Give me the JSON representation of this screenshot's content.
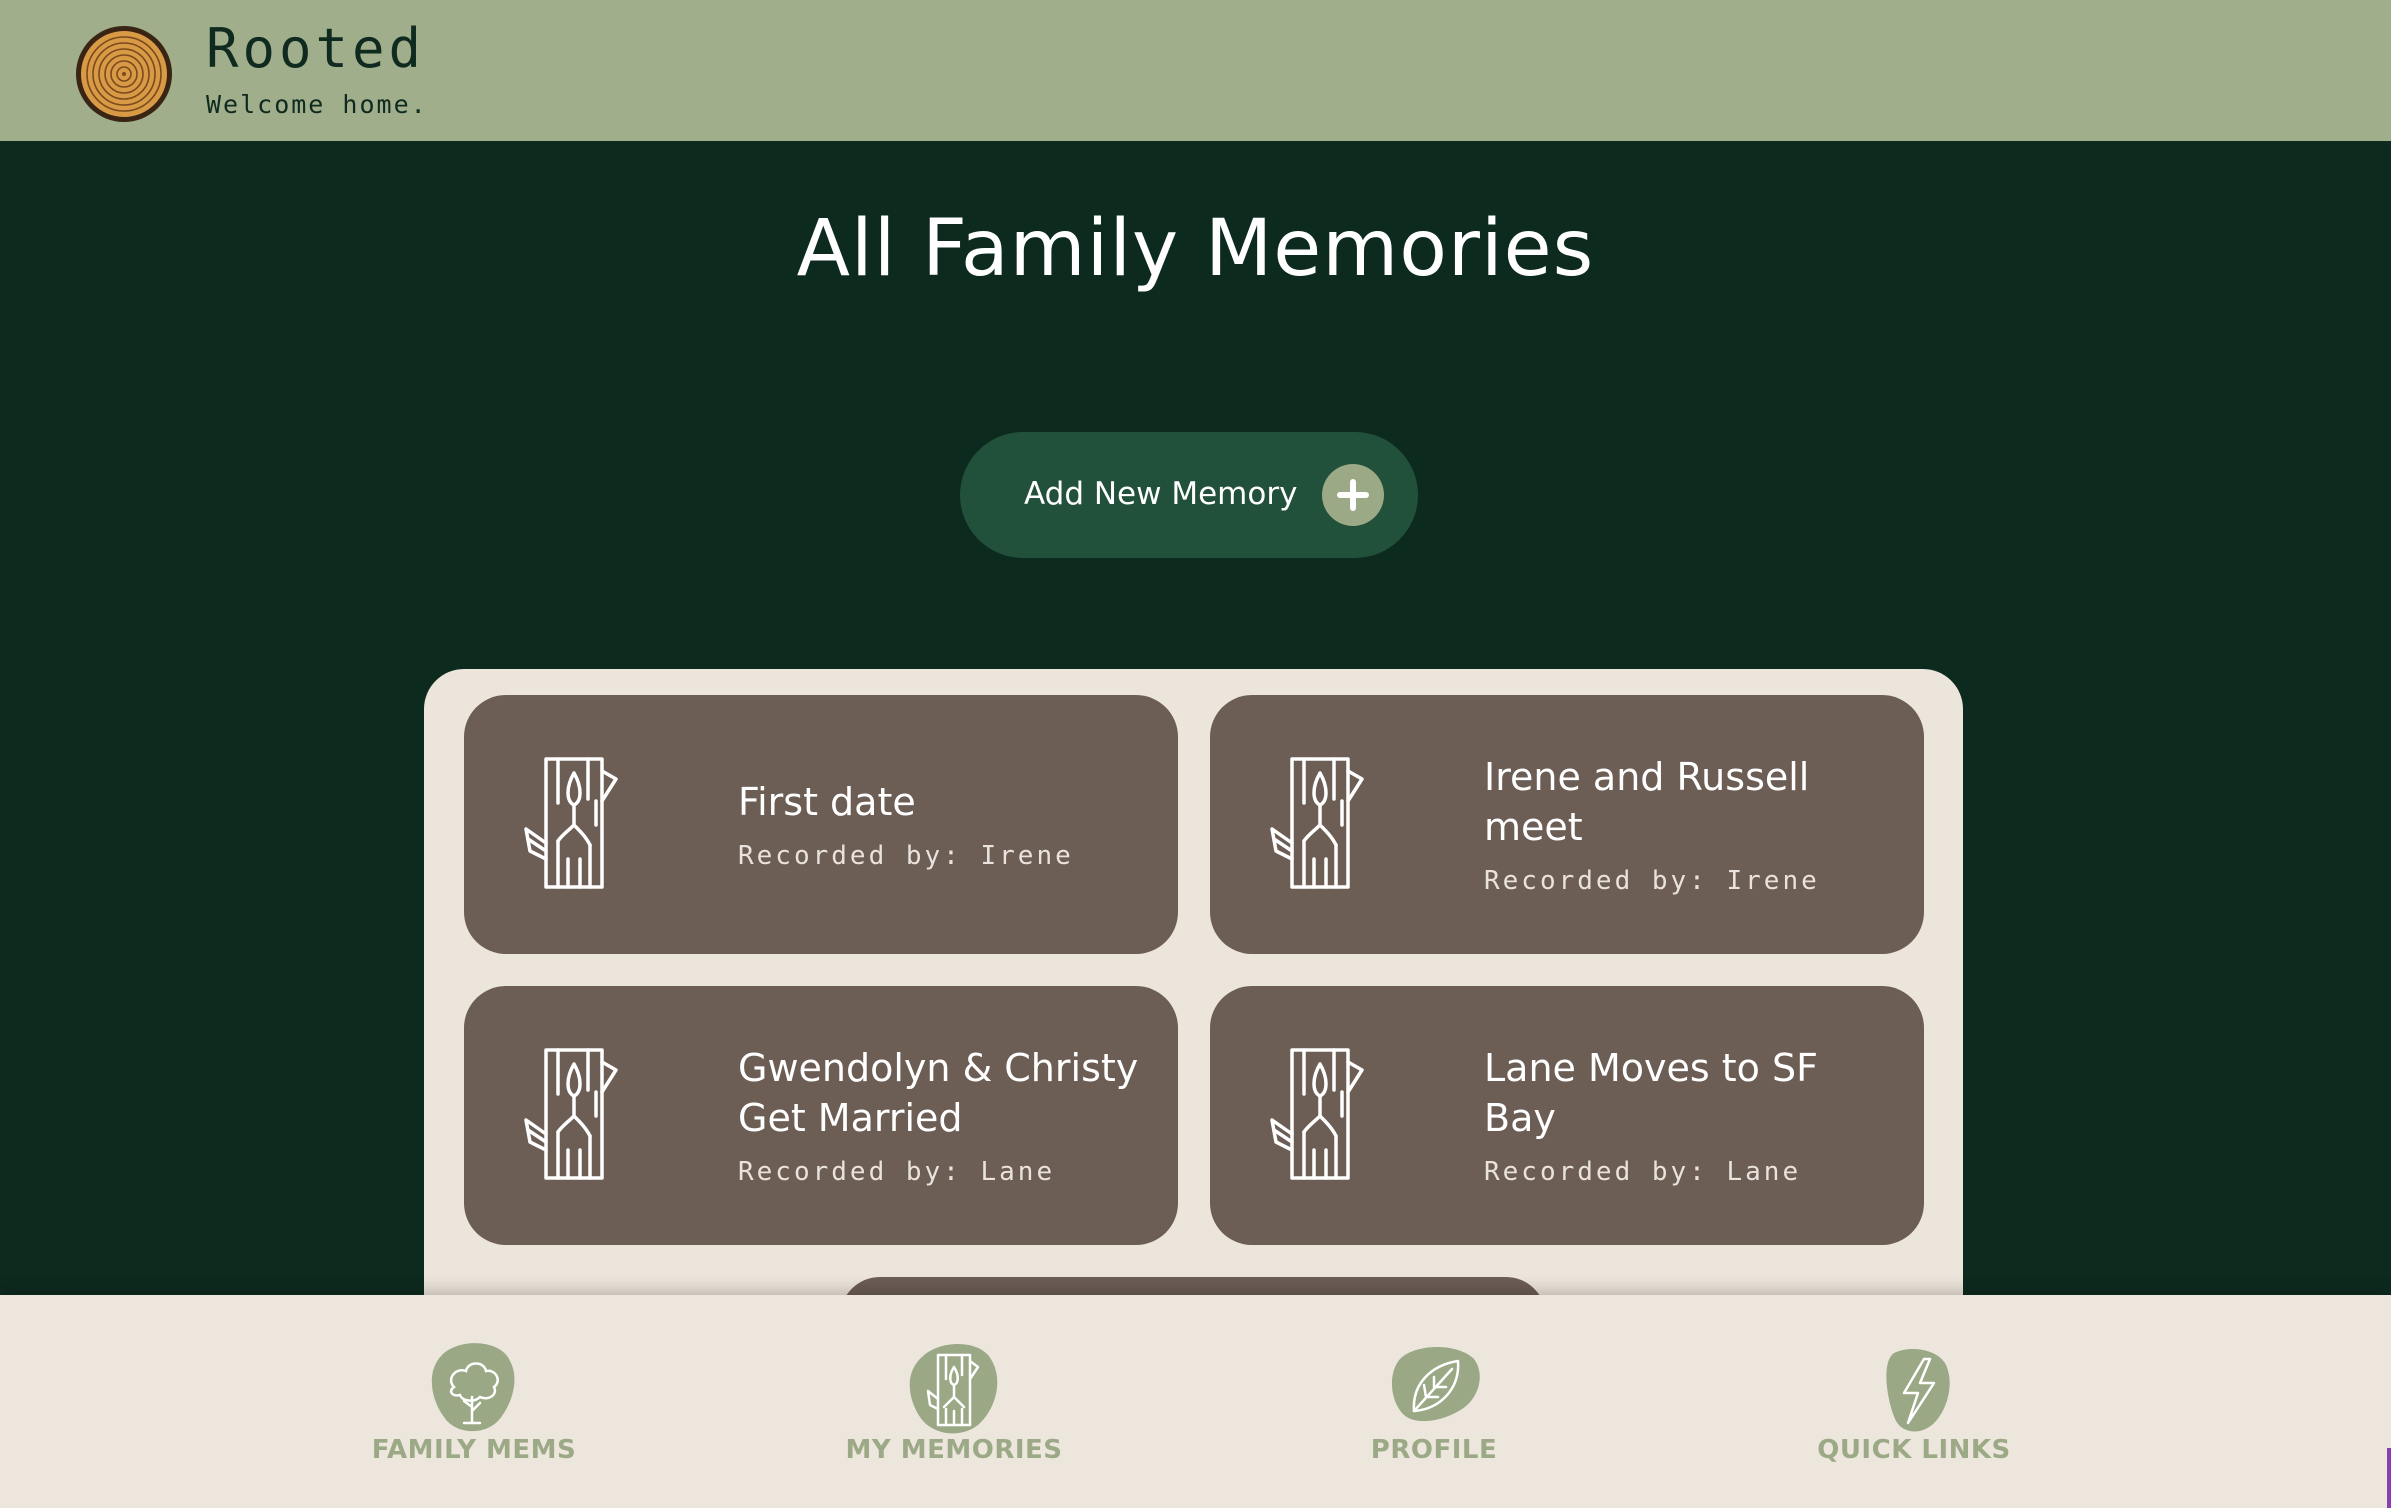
{
  "header": {
    "brand_title": "Rooted",
    "brand_tagline": "Welcome home.",
    "logo_icon": "tree-ring-icon"
  },
  "main": {
    "title": "All Family Memories",
    "add_button_label": "Add New Memory",
    "add_button_icon": "plus-icon"
  },
  "memories": [
    {
      "title": "First date",
      "recorded_by": "Recorded by: Irene",
      "icon": "tree-trunk-icon"
    },
    {
      "title": "Irene and Russell meet",
      "recorded_by": "Recorded by: Irene",
      "icon": "tree-trunk-icon"
    },
    {
      "title": "Gwendolyn & Christy Get Married",
      "recorded_by": "Recorded by: Lane",
      "icon": "tree-trunk-icon"
    },
    {
      "title": "Lane Moves to SF Bay",
      "recorded_by": "Recorded by: Lane",
      "icon": "tree-trunk-icon"
    }
  ],
  "nav": [
    {
      "label": "FAMILY MEMS",
      "icon": "tree-icon"
    },
    {
      "label": "MY MEMORIES",
      "icon": "tree-trunk-icon"
    },
    {
      "label": "PROFILE",
      "icon": "leaf-icon"
    },
    {
      "label": "QUICK LINKS",
      "icon": "lightning-icon"
    }
  ],
  "colors": {
    "background": "#0d2a1f",
    "header": "#a0ae8c",
    "button": "#21503b",
    "panel": "#ece5dc",
    "card": "#6c5d55",
    "nav_text": "#9ca986"
  }
}
